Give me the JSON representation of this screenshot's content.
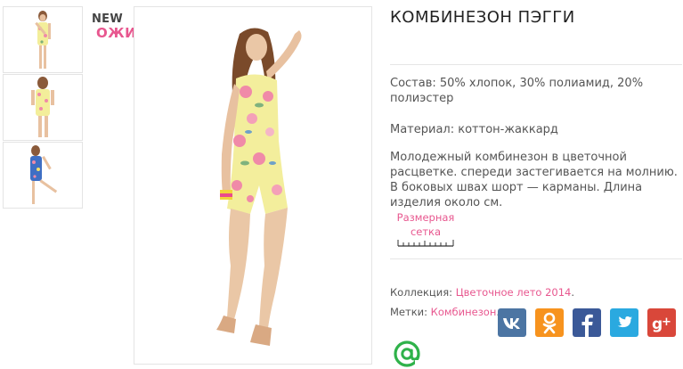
{
  "badges": {
    "new": "NEW",
    "status": "ОЖИДАЕТСЯ"
  },
  "product": {
    "title": "КОМБИНЕЗОН ПЭГГИ",
    "composition": "Состав: 50% хлопок, 30% полиамид, 20% полиэстер",
    "material": "Материал: коттон-жаккард",
    "description": "Молодежный комбинезон в цветочной расцветке.  спереди застегивается на молнию.  В боковых швах шорт — карманы. Длина изделия около  см.",
    "size_chart_link": "Размерная сетка"
  },
  "meta": {
    "collection_label": "Коллекция:",
    "collection_value": "Цветочное лето 2014",
    "tags_label": "Метки:",
    "tags_value": "Комбинезон"
  },
  "social": {
    "buttons": [
      {
        "name": "vk",
        "glyph": "vk",
        "color": "#4c75a3"
      },
      {
        "name": "odnoklassniki",
        "glyph": "ok",
        "color": "#f7931e"
      },
      {
        "name": "facebook",
        "glyph": "f",
        "color": "#3b5998"
      },
      {
        "name": "twitter",
        "glyph": "bird",
        "color": "#2aa9e0"
      },
      {
        "name": "google-plus",
        "glyph": "g+",
        "color": "#d9473a"
      }
    ],
    "mail_icon": {
      "glyph": "@",
      "color": "#2fb24a"
    }
  },
  "colors": {
    "accent": "#e8578f",
    "title": "#222222",
    "text": "#555555"
  }
}
